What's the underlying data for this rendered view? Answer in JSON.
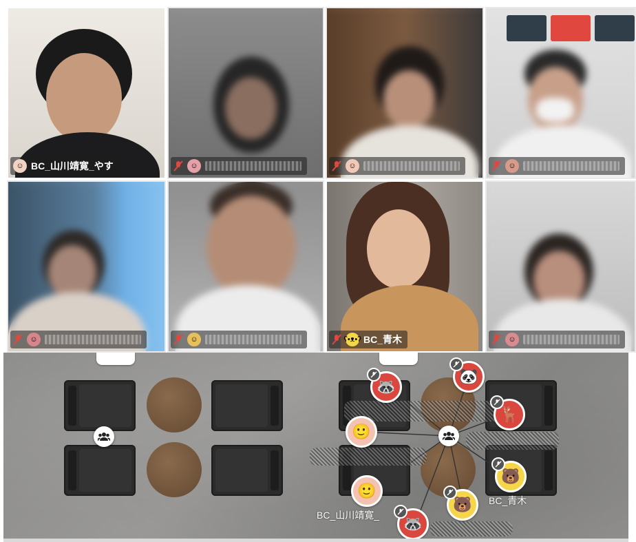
{
  "video_grid": {
    "tiles": [
      {
        "name": "BC_山川靖寛_やす",
        "avatar": "face-icon"
      },
      {
        "name": "",
        "avatar": "face-icon"
      },
      {
        "name": "",
        "avatar": "face-icon"
      },
      {
        "name": "",
        "avatar": "face-icon"
      },
      {
        "name": "",
        "avatar": "face-icon"
      },
      {
        "name": "",
        "avatar": "face-icon"
      },
      {
        "name": "BC_青木",
        "avatar": "bear-icon"
      },
      {
        "name": "",
        "avatar": "face-icon"
      }
    ]
  },
  "floor_map": {
    "avatar_labels": {
      "yamakawa": "BC_山川靖寛_",
      "aoki": "BC_青木"
    }
  },
  "colors": {
    "mute_red": "#e0473f",
    "floor_gray": "#8f8e8c",
    "table_wood": "#6f533a",
    "chair_dark": "#2b2b2b"
  }
}
